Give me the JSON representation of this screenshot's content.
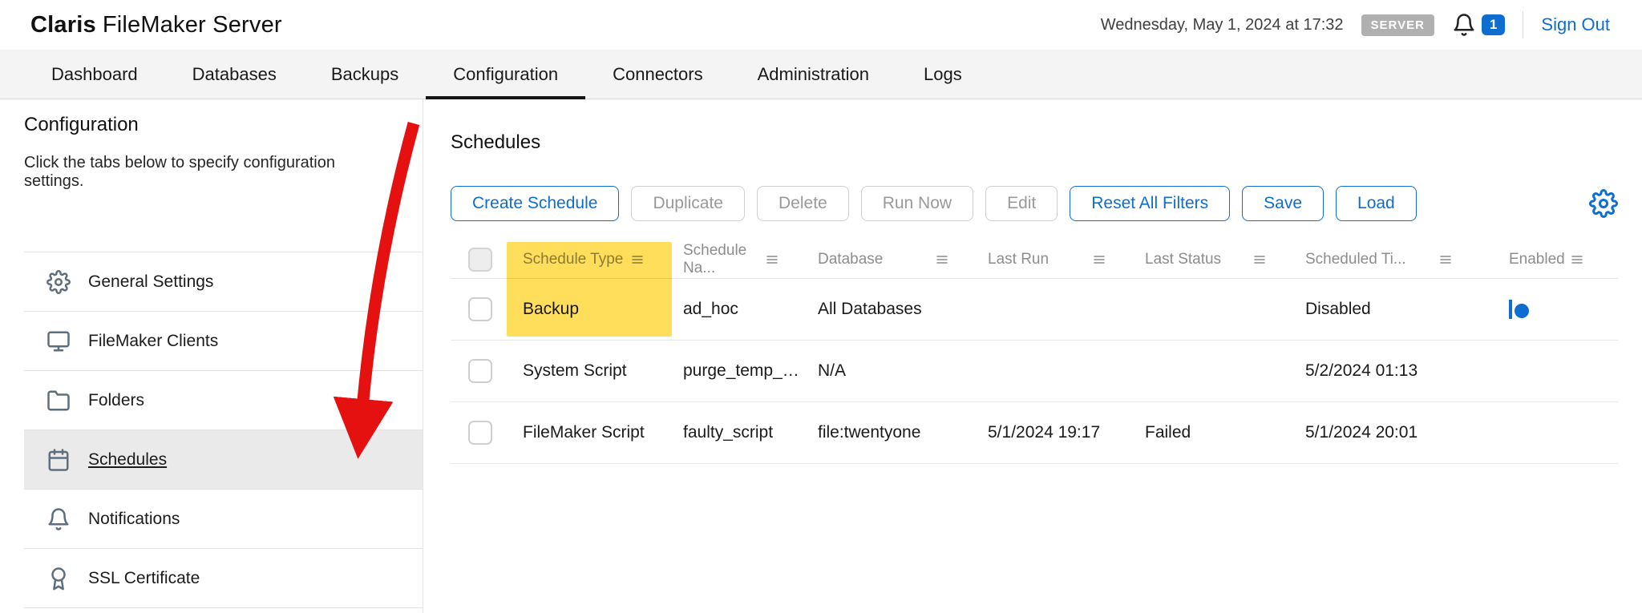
{
  "header": {
    "brand_claris": "Claris",
    "brand_product": "FileMaker Server",
    "datetime": "Wednesday, May 1, 2024 at 17:32",
    "server_badge": "SERVER",
    "notification_count": "1",
    "sign_out_label": "Sign Out"
  },
  "nav": {
    "tabs": [
      {
        "label": "Dashboard",
        "active": false
      },
      {
        "label": "Databases",
        "active": false
      },
      {
        "label": "Backups",
        "active": false
      },
      {
        "label": "Configuration",
        "active": true
      },
      {
        "label": "Connectors",
        "active": false
      },
      {
        "label": "Administration",
        "active": false
      },
      {
        "label": "Logs",
        "active": false
      }
    ]
  },
  "sidebar": {
    "title": "Configuration",
    "subtitle": "Click the tabs below to specify configuration settings.",
    "items": [
      {
        "label": "General Settings",
        "icon": "gear-icon",
        "active": false
      },
      {
        "label": "FileMaker Clients",
        "icon": "clients-icon",
        "active": false
      },
      {
        "label": "Folders",
        "icon": "folder-icon",
        "active": false
      },
      {
        "label": "Schedules",
        "icon": "calendar-icon",
        "active": true
      },
      {
        "label": "Notifications",
        "icon": "bell-icon",
        "active": false
      },
      {
        "label": "SSL Certificate",
        "icon": "certificate-icon",
        "active": false
      }
    ]
  },
  "main": {
    "title": "Schedules",
    "toolbar": {
      "create": "Create Schedule",
      "duplicate": "Duplicate",
      "delete": "Delete",
      "run_now": "Run Now",
      "edit": "Edit",
      "reset_filters": "Reset All Filters",
      "save": "Save",
      "load": "Load"
    },
    "table": {
      "columns": [
        "Schedule Type",
        "Schedule Na...",
        "Database",
        "Last Run",
        "Last Status",
        "Scheduled Ti...",
        "Enabled"
      ],
      "rows": [
        {
          "type": "Backup",
          "name": "ad_hoc",
          "database": "All Databases",
          "last_run": "",
          "last_status": "",
          "scheduled_time": "Disabled",
          "enabled": false
        },
        {
          "type": "System Script",
          "name": "purge_temp_db",
          "database": "N/A",
          "last_run": "",
          "last_status": "",
          "scheduled_time": "5/2/2024 01:13",
          "enabled": true
        },
        {
          "type": "FileMaker Script",
          "name": "faulty_script",
          "database": "file:twentyone",
          "last_run": "5/1/2024 19:17",
          "last_status": "Failed",
          "scheduled_time": "5/1/2024 20:01",
          "enabled": true
        }
      ]
    }
  },
  "annotations": {
    "yellow_highlight_target": "Schedule Type column header and Backup cell",
    "red_arrow_target": "Schedules sidebar item",
    "highlight_color": "#ffd633",
    "arrow_color": "#e51010"
  },
  "colors": {
    "accent_blue": "#0d6ecf",
    "nav_background": "#f4f4f4",
    "server_badge_gray": "#b0b0b0"
  }
}
